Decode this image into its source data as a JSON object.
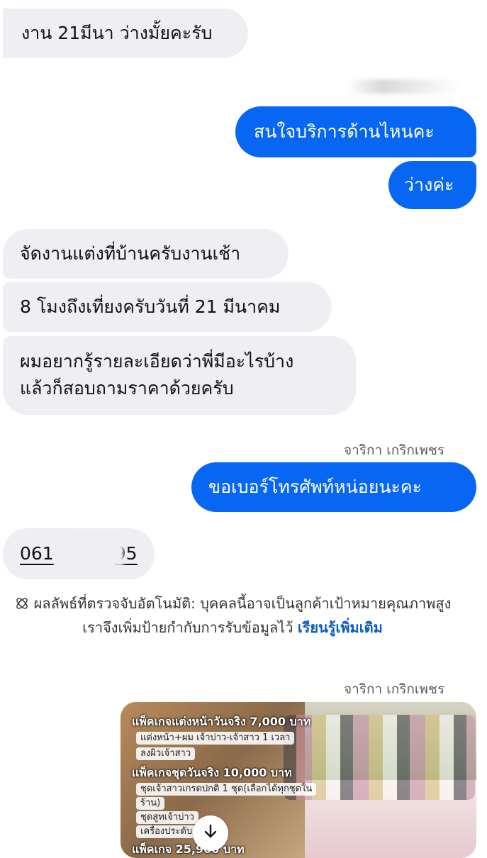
{
  "messages": {
    "m1": "งาน 21มีนา ว่างมั้ยคะรับ",
    "m2": "สนใจบริการด้านไหนคะ",
    "m3": "ว่างค่ะ",
    "m4": "จัดงานแต่งที่บ้านครับงานเช้า",
    "m5": "8 โมงถึงเที่ยงครับวันที่ 21 มีนาคม",
    "m6_line1": "ผมอยากรู้รายละเอียดว่าพี่มีอะไรบ้าง",
    "m6_line2": "แล้วก็สอบถามราคาด้วยครับ",
    "m7": "ขอเบอร์โทรศัพท์หน่อยนะคะ",
    "phone_start": "061",
    "phone_end": "95"
  },
  "sender_name": "จาริกา เกริกเพชร",
  "notice": {
    "text": "ผลลัพธ์ที่ตรวจจับอัตโนมัติ: บุคคลนี้อาจเป็นลูกค้าเป้าหมายคุณภาพสูง เราจึงเพิ่มป้ายกำกับการรับข้อมูลไว้",
    "link": "เรียนรู้เพิ่มเติม"
  },
  "media": {
    "package1_title": "แพ็คเกจแต่งหน้าวันจริง 7,000 บาท",
    "package1_items": [
      "แต่งหน้า+ผม เจ้าบ่าว-เจ้าสาว 1 เวลา",
      "ลงผิวเจ้าสาว"
    ],
    "package2_title": "แพ็คเกจชุดวันจริง 10,000 บาท",
    "package2_items": [
      "ชุดเจ้าสาวเกรดปกติ 1 ชุด(เลือกได้ทุกชุดใน",
      "ร้าน)",
      "ชุดสูทเจ้าบ่าว",
      "เครื่องประดับ"
    ],
    "package3_title": "แพ็คเกจ 25,900 บาท"
  },
  "colors": {
    "outgoing": "#0766f2",
    "incoming": "#eeeef3",
    "link": "#0a5ac2"
  }
}
